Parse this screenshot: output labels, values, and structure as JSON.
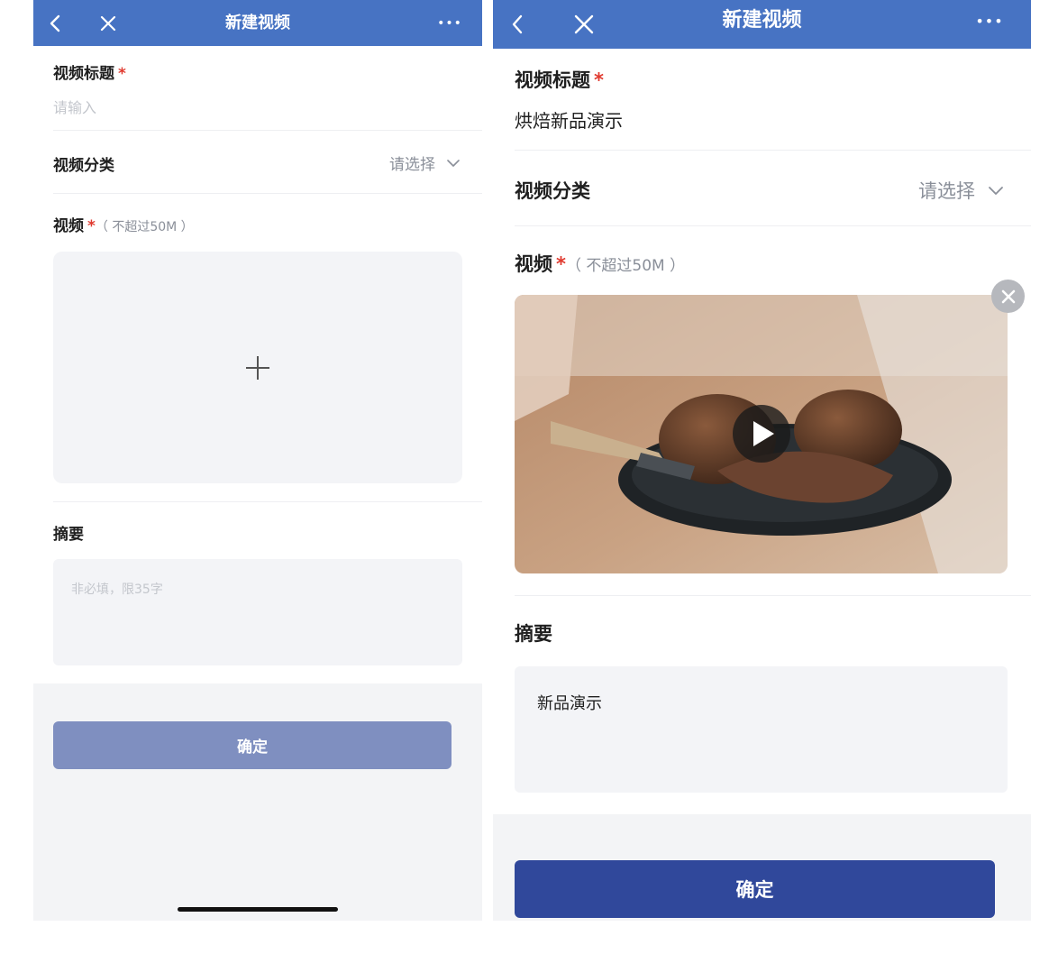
{
  "screen_empty": {
    "navbar": {
      "title": "新建视频",
      "more": "•••"
    },
    "title_field": {
      "label": "视频标题",
      "required": "*",
      "placeholder": "请输入"
    },
    "category_field": {
      "label": "视频分类",
      "value": "请选择"
    },
    "video_field": {
      "label": "视频",
      "required": "*",
      "hint": "（ 不超过50M ）",
      "add_symbol": "+"
    },
    "summary_field": {
      "label": "摘要",
      "placeholder": "非必填，限35字"
    },
    "confirm_label": "确定"
  },
  "screen_filled": {
    "navbar": {
      "title": "新建视频",
      "more": "•••"
    },
    "title_field": {
      "label": "视频标题",
      "required": "*",
      "value": "烘焙新品演示"
    },
    "category_field": {
      "label": "视频分类",
      "value": "请选择"
    },
    "video_field": {
      "label": "视频",
      "required": "*",
      "hint": "（ 不超过50M ）"
    },
    "summary_field": {
      "label": "摘要",
      "value": "新品演示"
    },
    "confirm_label": "确定"
  },
  "colors": {
    "navbar": "#4773c3",
    "required": "#e03a2f",
    "button_disabled": "#7f8fc0",
    "button_active": "#30489b",
    "field_bg": "#f3f4f7"
  }
}
